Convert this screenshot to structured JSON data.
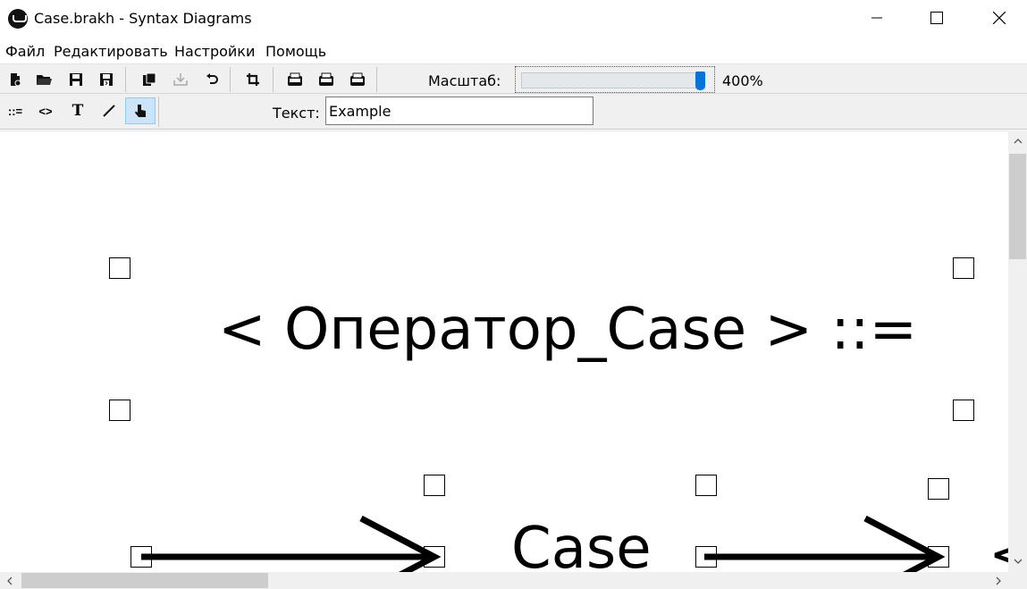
{
  "window": {
    "title": "Case.brakh - Syntax Diagrams"
  },
  "menu": {
    "items": [
      "Файл",
      "Редактировать",
      "Настройки",
      "Помощь"
    ]
  },
  "toolbar": {
    "scale_label": "Масштаб:",
    "scale_value": "400%",
    "scale_fraction": 1.0,
    "buttons": [
      "new-file-icon",
      "open-folder-icon",
      "save-icon",
      "save-as-icon",
      "copy-icon",
      "paste-icon",
      "undo-icon",
      "crop-icon",
      "export-bmp-icon",
      "export-svg-icon",
      "export-png-icon"
    ]
  },
  "tools": {
    "definition_label": "::=",
    "nonterminal_label": "<>",
    "text_label": "T",
    "text_field_label": "Текст:",
    "text_field_value": "Example",
    "active_tool": "pointer"
  },
  "diagram": {
    "rule_title": "< Оператор_Case > ::=",
    "keyword": "Case",
    "next_glyph": "<"
  },
  "colors": {
    "accent": "#0a74d6",
    "toolbar_bg": "#f0f0f0",
    "active_tool_bg": "#cce4f7"
  }
}
